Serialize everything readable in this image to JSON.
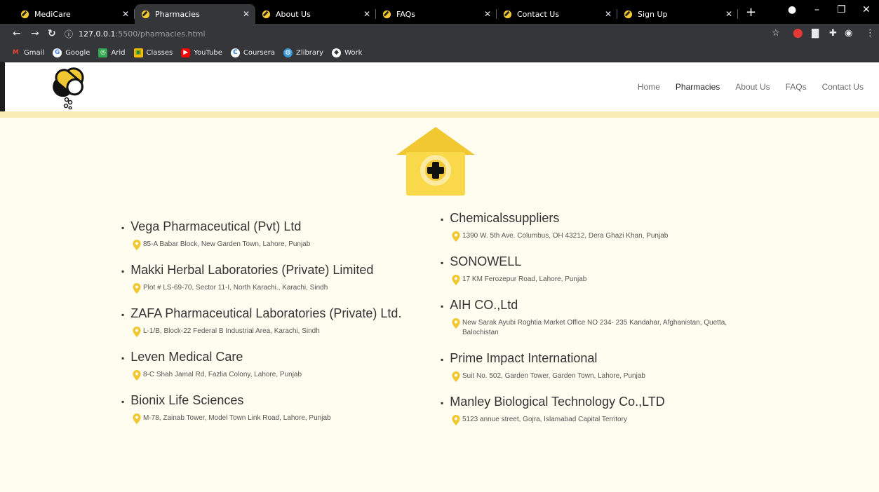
{
  "browser": {
    "tabs": [
      {
        "label": "MediCare",
        "active": false
      },
      {
        "label": "Pharmacies",
        "active": true
      },
      {
        "label": "About Us",
        "active": false
      },
      {
        "label": "FAQs",
        "active": false
      },
      {
        "label": "Contact Us",
        "active": false
      },
      {
        "label": "Sign Up",
        "active": false
      }
    ],
    "url_host": "127.0.0.1",
    "url_path": ":5500/pharmacies.html",
    "bookmarks": [
      {
        "label": "Gmail",
        "icon": "gmail-icon",
        "color": "#ea4335"
      },
      {
        "label": "Google",
        "icon": "google-icon",
        "color": "#4285f4"
      },
      {
        "label": "Arid",
        "icon": "arid-icon",
        "color": "#34a853"
      },
      {
        "label": "Classes",
        "icon": "classroom-icon",
        "color": "#fbbc04"
      },
      {
        "label": "YouTube",
        "icon": "youtube-icon",
        "color": "#ff0000"
      },
      {
        "label": "Coursera",
        "icon": "coursera-icon",
        "color": "#2a73cc"
      },
      {
        "label": "Zlibrary",
        "icon": "zlibrary-icon",
        "color": "#3a9bd9"
      },
      {
        "label": "Work",
        "icon": "work-icon",
        "color": "#ffffff"
      }
    ]
  },
  "site": {
    "accent": "#f2c832",
    "accent_light": "#f8eeb5",
    "nav": [
      {
        "label": "Home",
        "active": false
      },
      {
        "label": "Pharmacies",
        "active": true
      },
      {
        "label": "About Us",
        "active": false
      },
      {
        "label": "FAQs",
        "active": false
      },
      {
        "label": "Contact Us",
        "active": false
      }
    ]
  },
  "pharmacies_left": [
    {
      "name": "Vega Pharmaceutical (Pvt) Ltd",
      "address": "85-A Babar Block, New Garden Town, Lahore, Punjab"
    },
    {
      "name": "Makki Herbal Laboratories (Private) Limited",
      "address": "Plot # LS-69-70, Sector 11-I, North Karachi., Karachi, Sindh"
    },
    {
      "name": "ZAFA Pharmaceutical Laboratories (Private) Ltd.",
      "address": "L-1/B, Block-22 Federal B Industrial Area, Karachi, Sindh"
    },
    {
      "name": "Leven Medical Care",
      "address": "8-C Shah Jamal Rd, Fazlia Colony, Lahore, Punjab"
    },
    {
      "name": "Bionix Life Sciences",
      "address": "M-78, Zainab Tower, Model Town Link Road, Lahore, Punjab"
    }
  ],
  "pharmacies_right": [
    {
      "name": "Chemicalssuppliers",
      "address": "1390 W. 5th Ave. Columbus, OH 43212, Dera Ghazi Khan, Punjab"
    },
    {
      "name": "SONOWELL",
      "address": "17 KM Ferozepur Road, Lahore, Punjab"
    },
    {
      "name": "AIH CO.,Ltd",
      "address": "New Sarak Ayubi Roghtia Market Office NO 234- 235 Kandahar, Afghanistan, Quetta, Balochistan"
    },
    {
      "name": "Prime Impact International",
      "address": "Suit No. 502, Garden Tower, Garden Town, Lahore, Punjab"
    },
    {
      "name": "Manley Biological Technology Co.,LTD",
      "address": "5123 annue street, Gojra, Islamabad Capital Territory"
    }
  ]
}
